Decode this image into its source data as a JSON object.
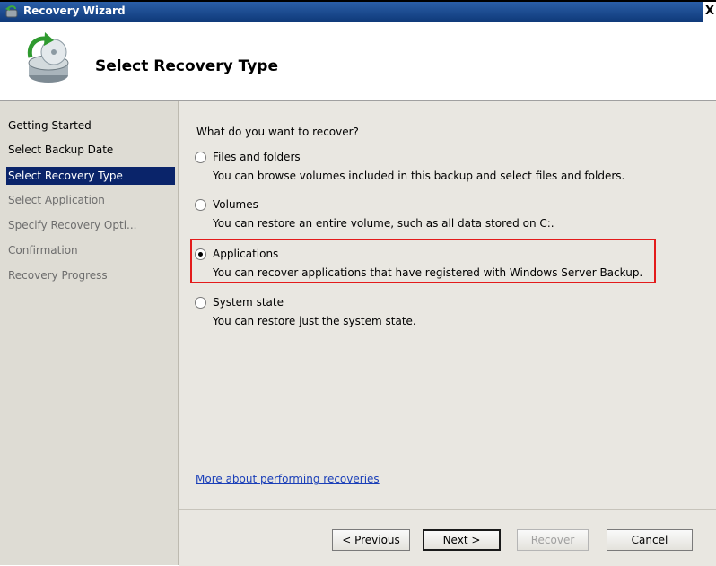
{
  "window": {
    "title": "Recovery Wizard",
    "close_glyph": "X"
  },
  "header": {
    "title": "Select Recovery Type",
    "icon": "backup-restore-icon"
  },
  "steps": [
    {
      "label": "Getting Started",
      "state": "done"
    },
    {
      "label": "Select Backup Date",
      "state": "done"
    },
    {
      "label": "Select Recovery Type",
      "state": "active"
    },
    {
      "label": "Select Application",
      "state": "todo"
    },
    {
      "label": "Specify Recovery Opti...",
      "state": "todo"
    },
    {
      "label": "Confirmation",
      "state": "todo"
    },
    {
      "label": "Recovery Progress",
      "state": "todo"
    }
  ],
  "main": {
    "question": "What do you want to recover?",
    "options": [
      {
        "label": "Files and folders",
        "description": "You can browse volumes included in this backup and select files and folders.",
        "selected": false
      },
      {
        "label": "Volumes",
        "description": "You can restore an entire volume, such as all data stored on C:.",
        "selected": false
      },
      {
        "label": "Applications",
        "description": "You can recover applications that have registered with Windows Server Backup.",
        "selected": true
      },
      {
        "label": "System state",
        "description": "You can restore just the system state.",
        "selected": false
      }
    ],
    "help_link": "More about performing recoveries"
  },
  "buttons": {
    "previous": "< Previous",
    "next": "Next >",
    "recover": "Recover",
    "cancel": "Cancel"
  },
  "colors": {
    "title_bar": "#0f3a7a",
    "active_step": "#0a246a",
    "highlight": "#e31b1b",
    "link": "#1a3fb8"
  }
}
